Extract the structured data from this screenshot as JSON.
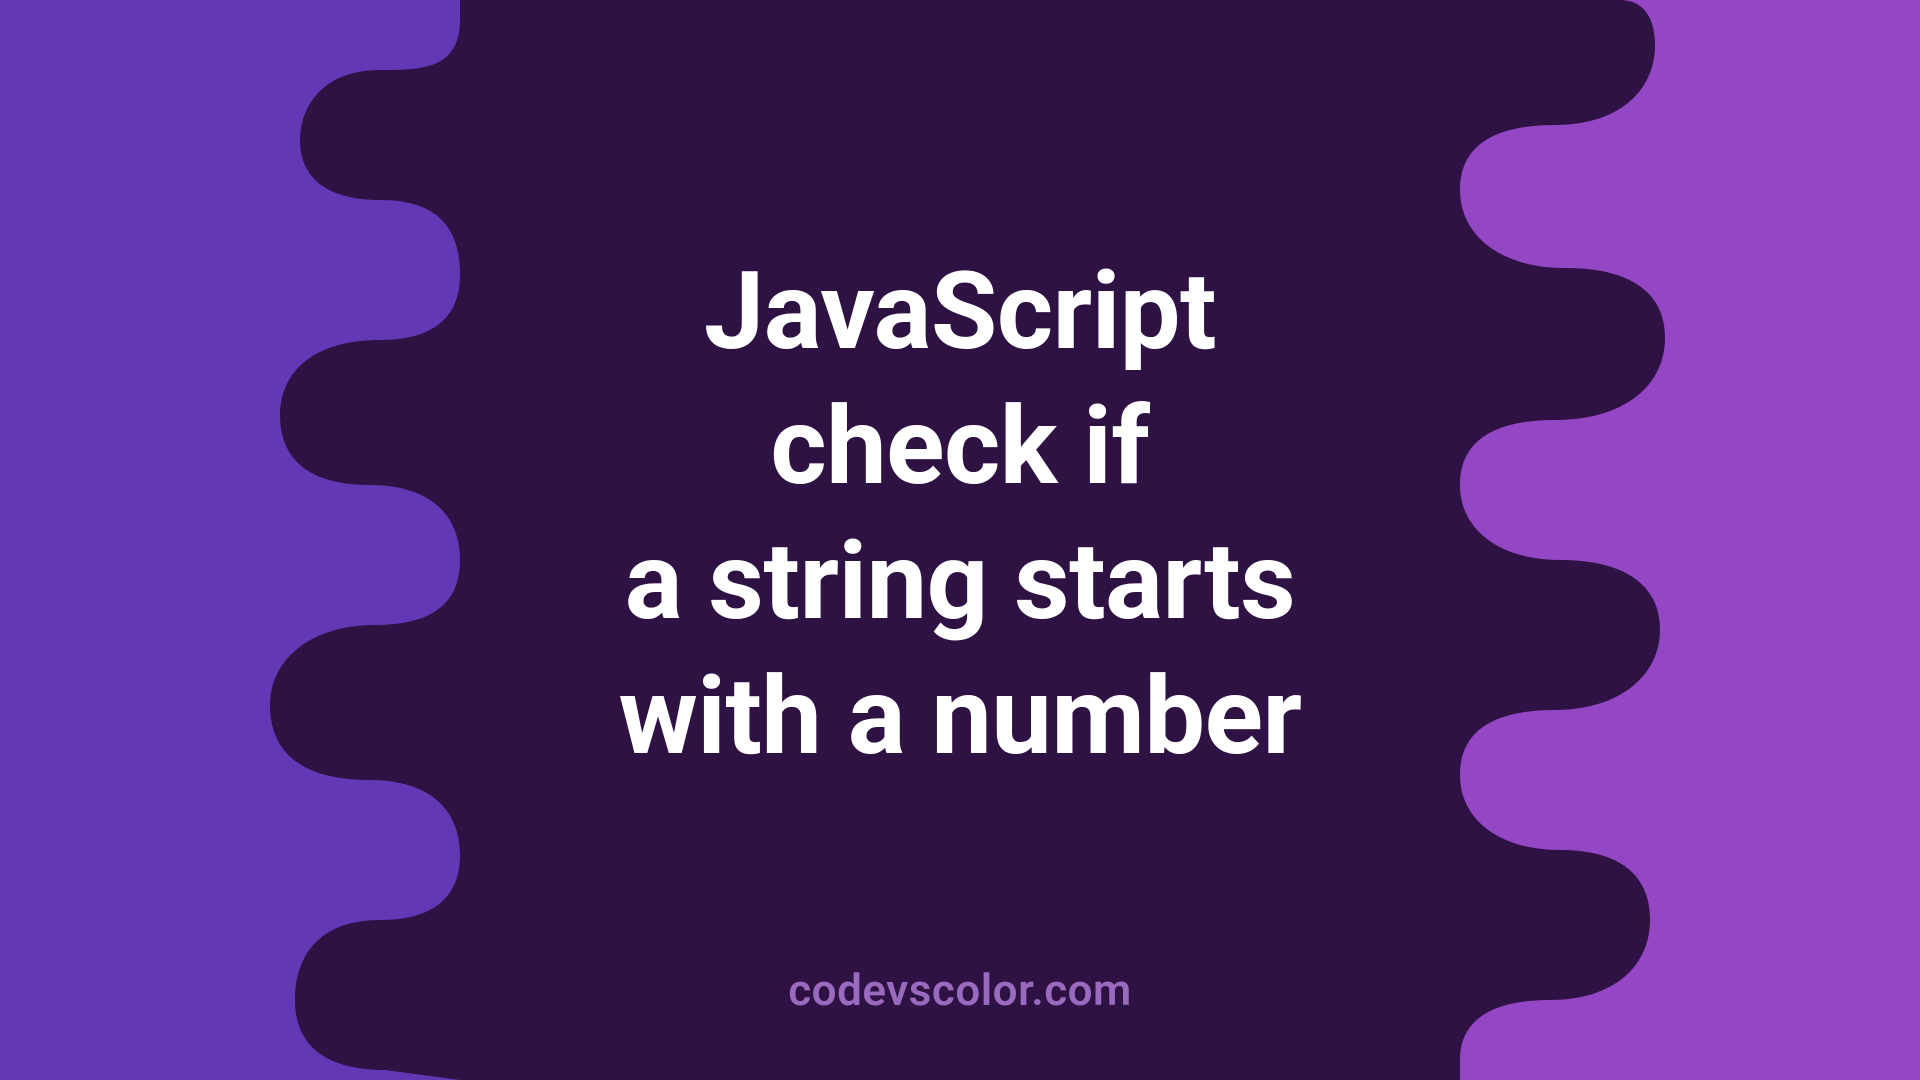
{
  "colors": {
    "bg_left": "#6238b5",
    "bg_right": "#9347c4",
    "blob": "#2d1243",
    "title": "#ffffff",
    "footer": "#9a6abf"
  },
  "title_lines": [
    "JavaScript",
    "check if",
    "a string starts",
    "with a number"
  ],
  "footer": "codevscolor.com"
}
